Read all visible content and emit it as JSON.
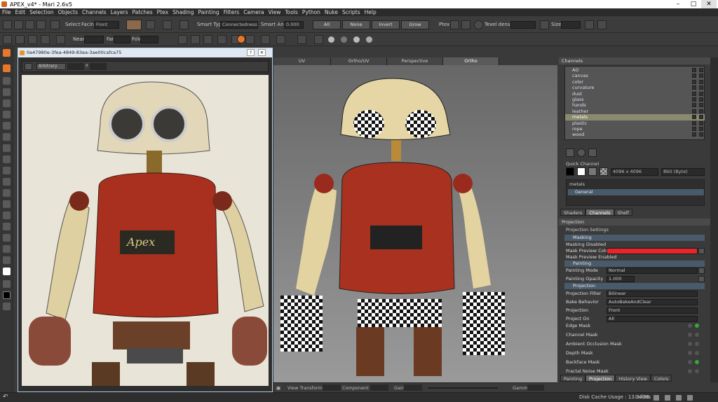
{
  "window": {
    "title": "APEX_v4* - Mari 2.6v5"
  },
  "menu": [
    "File",
    "Edit",
    "Selection",
    "Objects",
    "Channels",
    "Layers",
    "Patches",
    "Ptex",
    "Shading",
    "Painting",
    "Filters",
    "Camera",
    "View",
    "Tools",
    "Python",
    "Nuke",
    "Scripts",
    "Help"
  ],
  "toolbar": {
    "select_label": "Select",
    "facing_label": "Facing",
    "facing_value": "Front",
    "smart_type_label": "Smart Type:",
    "smart_type_value": "Connectedness",
    "smart_angle_label": "Smart Angle",
    "smart_angle_value": "0.000",
    "all_button": "All",
    "none_button": "None",
    "invert_button": "Invert",
    "grow_button": "Grow",
    "ptex_label": "Ptex",
    "texel_density_label": "Texel density",
    "size_label": "Size",
    "near_label": "Near",
    "far_label": "Far",
    "fov_label": "FoV"
  },
  "image_window": {
    "title": "0a47980e-3fea-4849-83ea-3ae00cafca75",
    "mode": "Arbitrary",
    "x_label": "x"
  },
  "viewport": {
    "tabs": [
      "UV",
      "Ortho/UV",
      "Perspective",
      "Ortho"
    ],
    "active_tab": "Ortho",
    "status": {
      "view_transform": "View Transform",
      "component": "Component",
      "gain": "Gain",
      "gamma": "Gamma"
    }
  },
  "channels": {
    "panel_title": "Channels",
    "items": [
      "AO",
      "canvas",
      "color",
      "curvature",
      "dust",
      "glass",
      "hands",
      "leather",
      "metals",
      "plastic",
      "rope",
      "wood"
    ],
    "selected": "metals",
    "quick_channel_label": "Quick Channel",
    "resolution": "4096 x 4096",
    "depth": "8bit (Byte)",
    "layer_name": "metals",
    "general_label": "General"
  },
  "panel_tabs_top": [
    "Shaders",
    "Channels",
    "Shelf"
  ],
  "projection": {
    "panel_title": "Projection",
    "settings_label": "Projection Settings",
    "masking_section": "Masking",
    "masking_disabled": "Masking Disabled",
    "mask_preview_color": "Mask Preview Color",
    "mask_preview_enabled": "Mask Preview Enabled",
    "painting_section": "Painting",
    "painting_mode_label": "Painting Mode",
    "painting_mode_value": "Normal",
    "painting_opacity_label": "Painting Opacity",
    "painting_opacity_value": "1.000",
    "projection_section": "Projection",
    "projection_filter_label": "Projection Filter",
    "projection_filter_value": "Bilinear",
    "bake_behavior_label": "Bake Behavior",
    "bake_behavior_value": "AutoBakeAndClear",
    "projection_label": "Projection",
    "projection_value": "Front",
    "project_on_label": "Project On",
    "project_on_value": "All",
    "masks": [
      "Edge Mask",
      "Channel Mask",
      "Ambient Occlusion Mask",
      "Depth Mask",
      "Backface Mask",
      "Fractal Noise Mask"
    ]
  },
  "panel_tabs_bottom": [
    "Painting",
    "Projection",
    "History View",
    "Colors"
  ],
  "status": {
    "disk_cache": "Disk Cache Usage : 13.34GB",
    "udims": "Udims"
  },
  "colors": {
    "accent": "#e8772a",
    "mask_red": "#e8262a",
    "selected_row": "#8a8a6e"
  }
}
